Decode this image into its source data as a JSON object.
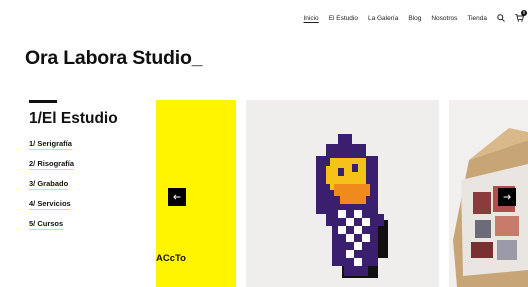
{
  "nav": {
    "items": [
      {
        "label": "Inicio",
        "active": true
      },
      {
        "label": "El Estudio",
        "active": false
      },
      {
        "label": "La Galería",
        "active": false
      },
      {
        "label": "Blog",
        "active": false
      },
      {
        "label": "Nosotros",
        "active": false
      },
      {
        "label": "Tienda",
        "active": false
      }
    ],
    "icons": [
      "search-icon",
      "cart-icon"
    ],
    "cart_count": "0"
  },
  "brand": {
    "name": "Ora Labora Studio_"
  },
  "sidebar": {
    "title": "1/El Estudio",
    "items": [
      {
        "label": "1/ Serigrafía"
      },
      {
        "label": "2/ Risografía"
      },
      {
        "label": "3/ Grabado"
      },
      {
        "label": "4/ Servicios"
      },
      {
        "label": "5/ Cursos"
      }
    ]
  },
  "carousel": {
    "slides": [
      {
        "caption": "ACcTo",
        "background": "#fff500"
      },
      {
        "caption": "",
        "background": "#efeeec"
      },
      {
        "caption": "",
        "background": "#f1f0ee"
      }
    ],
    "prev_icon": "arrow-left-icon",
    "next_icon": "arrow-right-icon"
  },
  "colors": {
    "accent": "#f6ea14",
    "yellow": "#fff500",
    "purple": "#3a1f6e",
    "orange": "#f5a623"
  }
}
